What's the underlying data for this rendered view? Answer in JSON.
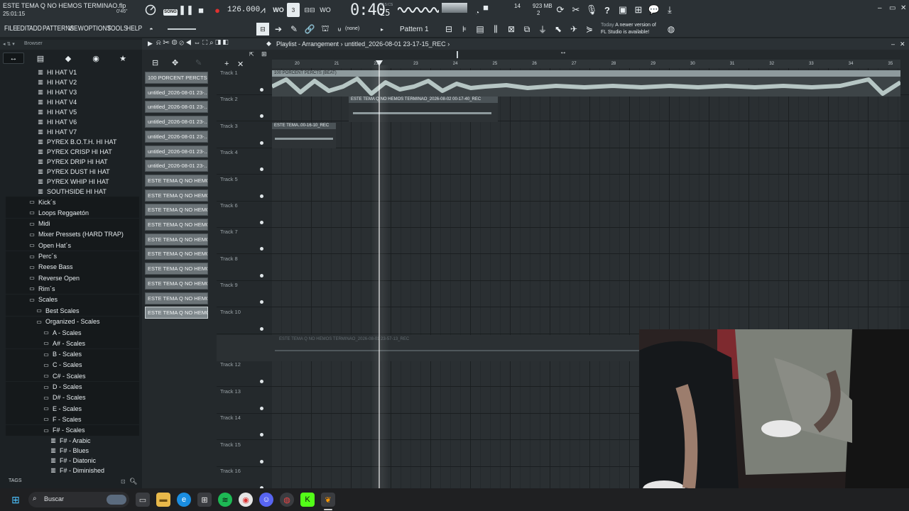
{
  "app": {
    "file_title": "ESTE TEMA Q NO HEMOS TERMINAO.flp",
    "file_time": "25:01:15",
    "song_badge": "SONG",
    "step_time": "0'46\"",
    "tempo": "126.000",
    "clock_main": "0:40",
    "clock_sub": "25",
    "clock_units": "M:S:CS",
    "cpu": "14",
    "mem": "923 MB",
    "mem2": "2"
  },
  "menu": [
    "FILE",
    "EDIT",
    "ADD",
    "PATTERNS",
    "VIEW",
    "OPTIONS",
    "TOOLS",
    "HELP"
  ],
  "toolbar": {
    "none_label": "(none)",
    "pattern_label": "Pattern 1",
    "news_muted": "Today",
    "news_line1": "A newer version of",
    "news_line2": "FL Studio is available!"
  },
  "browser": {
    "header": "Browser",
    "tags_label": "TAGS",
    "hihats": [
      "HI HAT V1",
      "HI HAT V2",
      "HI HAT V3",
      "HI HAT V4",
      "HI HAT V5",
      "HI HAT V6",
      "HI HAT V7",
      "PYREX B.O.T.H. HI HAT",
      "PYREX CRISP HI HAT",
      "PYREX DRIP HI HAT",
      "PYREX DUST HI HAT",
      "PYREX WHIP HI HAT",
      "SOUTHSIDE HI HAT"
    ],
    "folders": [
      "Kick´s",
      "Loops Reggaetón",
      "Midi",
      "Mixer Pressets (HARD TRAP)",
      "Open Hat´s",
      "Perc´s",
      "Reese Bass",
      "Reverse Open",
      "Rim´s",
      "Scales"
    ],
    "scales_sub": [
      "Best Scales",
      "Organized - Scales"
    ],
    "organized": [
      "A - Scales",
      "A# - Scales",
      "B - Scales",
      "C - Scales",
      "C# - Scales",
      "D - Scales",
      "D# - Scales",
      "E - Scales",
      "F - Scales",
      "F# - Scales"
    ],
    "fsharp": [
      "F# - Arabic",
      "F# - Blues",
      "F# - Diatonic",
      "F# - Diminished"
    ]
  },
  "playlist": {
    "title_prefix": "Playlist - Arrangement",
    "title_file": "untitled_2026-08-01 23-17-15_REC",
    "picker": [
      "100 PORCENT PERCTS...",
      "untitled_2026-08-01 23-...",
      "untitled_2026-08-01 23-...",
      "untitled_2026-08-01 23-...",
      "untitled_2026-08-01 23-...",
      "untitled_2026-08-01 23-...",
      "untitled_2026-08-01 23-...",
      "ESTE TEMA Q NO HEMOS T...",
      "ESTE TEMA Q NO HEMOS T...",
      "ESTE TEMA Q NO HEMOS T...",
      "ESTE TEMA Q NO HEMOS T...",
      "ESTE TEMA Q NO HEMOS T...",
      "ESTE TEMA Q NO HEMOS T...",
      "ESTE TEMA Q NO HEMOS T...",
      "ESTE TEMA Q NO HEMOS T...",
      "ESTE TEMA Q NO HEMOS T...",
      "ESTE TEMA Q NO HEMOS T..."
    ],
    "tracks": [
      "Track 1",
      "Track 2",
      "Track 3",
      "Track 4",
      "Track 5",
      "Track 6",
      "Track 7",
      "Track 8",
      "Track 9",
      "Track 10",
      "Track 11",
      "Track 12",
      "Track 13",
      "Track 14",
      "Track 15",
      "Track 16"
    ],
    "bars": [
      "20",
      "21",
      "22",
      "23",
      "24",
      "25",
      "26",
      "27",
      "28",
      "29",
      "30",
      "31",
      "32",
      "33",
      "34",
      "35"
    ],
    "clips": {
      "track1": "100 PORCENT PERCTS (BEAT)",
      "track2": "ESTE TEMA Q NO HEMOS TERMINAO_2026-08-02 00-17-40_REC",
      "track3": "ESTE TEMA..00-16-10_REC",
      "track11": "ESTE TEMA Q NO HEMOS TERMINAO_2026-08-01 23-57-13_REC"
    }
  },
  "taskbar": {
    "search_label": "Buscar"
  }
}
